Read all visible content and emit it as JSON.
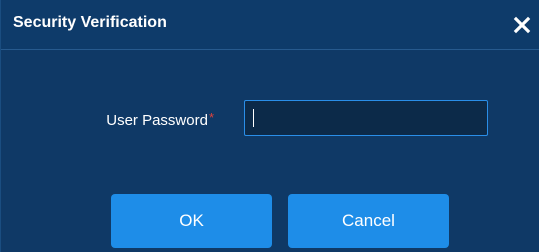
{
  "dialog": {
    "title": "Security Verification",
    "close_icon": "close-icon"
  },
  "form": {
    "password_label": "User Password",
    "required_marker": "*",
    "password_value": ""
  },
  "actions": {
    "ok_label": "OK",
    "cancel_label": "Cancel"
  },
  "colors": {
    "background": "#0f3966",
    "accent": "#1e8de8",
    "input_border": "#2a8ee8",
    "required": "#e0433b"
  }
}
